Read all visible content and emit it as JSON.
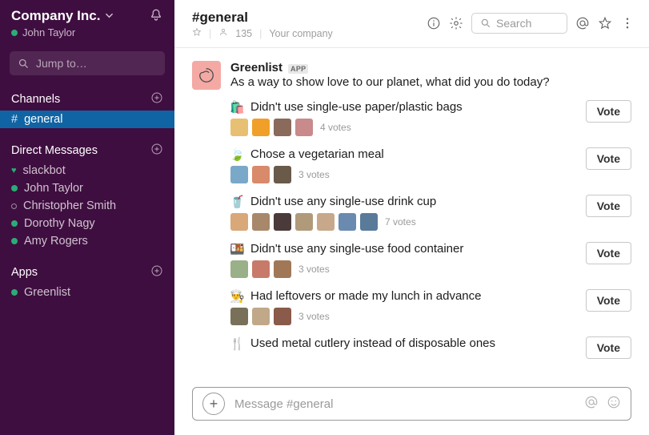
{
  "workspace": {
    "name": "Company Inc.",
    "user": "John Taylor"
  },
  "jump_placeholder": "Jump to…",
  "sections": {
    "channels": {
      "title": "Channels",
      "items": [
        {
          "name": "general",
          "active": true
        }
      ]
    },
    "dms": {
      "title": "Direct Messages",
      "items": [
        {
          "name": "slackbot",
          "presence": "heart"
        },
        {
          "name": "John Taylor",
          "presence": "online"
        },
        {
          "name": "Christopher Smith",
          "presence": "away"
        },
        {
          "name": "Dorothy Nagy",
          "presence": "online"
        },
        {
          "name": "Amy Rogers",
          "presence": "online"
        }
      ]
    },
    "apps": {
      "title": "Apps",
      "items": [
        {
          "name": "Greenlist",
          "presence": "online"
        }
      ]
    }
  },
  "header": {
    "channel": "#general",
    "members": "135",
    "topic": "Your company",
    "search_placeholder": "Search"
  },
  "message": {
    "author": "Greenlist",
    "badge": "APP",
    "text": "As a way to show love to our planet, what did you do today?",
    "options": [
      {
        "emoji": "🛍️",
        "label": "Didn't use single-use paper/plastic bags",
        "count": "4 votes",
        "voters": [
          "#e8c074",
          "#f0a028",
          "#8a6a5a",
          "#c88a8a"
        ]
      },
      {
        "emoji": "🍃",
        "label": "Chose a vegetarian meal",
        "count": "3 votes",
        "voters": [
          "#7aa8c8",
          "#d88a6a",
          "#6a5a4a"
        ]
      },
      {
        "emoji": "🥤",
        "label": "Didn't use any single-use drink cup",
        "count": "7 votes",
        "voters": [
          "#d8a878",
          "#a8886a",
          "#4a3a3a",
          "#b09a7a",
          "#c8a88a",
          "#6a8ab0",
          "#5a7a9a"
        ]
      },
      {
        "emoji": "🍱",
        "label": "Didn't use any single-use food container",
        "count": "3 votes",
        "voters": [
          "#9ab088",
          "#c87a6a",
          "#a07858"
        ]
      },
      {
        "emoji": "👨‍🍳",
        "label": "Had leftovers or made my lunch in advance",
        "count": "3 votes",
        "voters": [
          "#787058",
          "#c0a888",
          "#8a5a4a"
        ]
      },
      {
        "emoji": "🍴",
        "label": "Used metal cutlery instead of disposable ones",
        "count": "",
        "voters": []
      }
    ],
    "vote_label": "Vote"
  },
  "composer": {
    "placeholder": "Message #general"
  }
}
